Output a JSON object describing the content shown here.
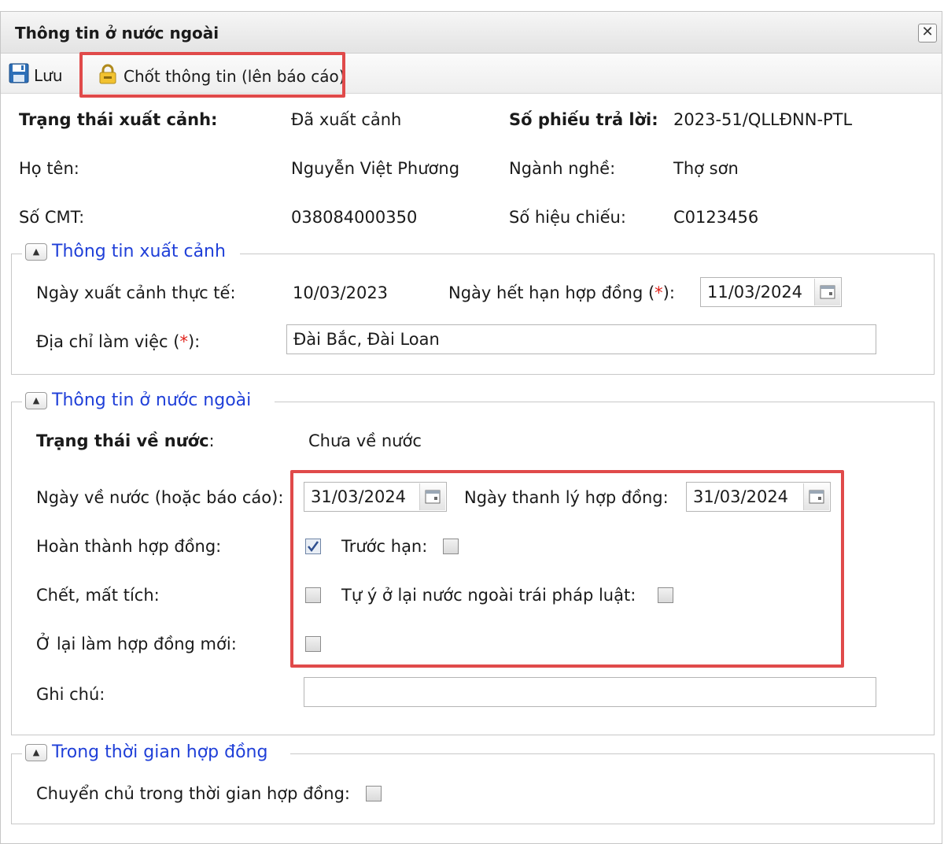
{
  "window": {
    "title": "Thông tin ở nước ngoài",
    "close_glyph": "✕"
  },
  "toolbar": {
    "save_label": "Lưu",
    "lock_label": "Chốt thông tin (lên báo cáo)"
  },
  "summary": {
    "exit_status_label": "Trạng thái xuất cảnh:",
    "exit_status_value": "Đã xuất cảnh",
    "reply_no_label": "Số phiếu trả lời:",
    "reply_no_value": "2023-51/QLLĐNN-PTL",
    "name_label": "Họ tên:",
    "name_value": "Nguyễn Việt Phương",
    "occupation_label": "Ngành nghề:",
    "occupation_value": "Thợ sơn",
    "id_label": "Số CMT:",
    "id_value": "038084000350",
    "passport_label": "Số hiệu chiếu:",
    "passport_value": "C0123456"
  },
  "exit_section": {
    "legend": "Thông tin xuất cảnh",
    "actual_exit_label": "Ngày xuất cảnh thực tế:",
    "actual_exit_value": "10/03/2023",
    "contract_end_label": "Ngày hết hạn hợp đồng (",
    "contract_end_value": "11/03/2024",
    "work_address_label": "Địa chỉ làm việc (",
    "work_address_value": "Đài Bắc, Đài Loan",
    "required_mark": "*",
    "label_close": "):"
  },
  "abroad_section": {
    "legend": "Thông tin ở nước ngoài",
    "return_status_label": "Trạng thái về nước",
    "return_status_colon": ":",
    "return_status_value": "Chưa về nước",
    "return_date_label": "Ngày về nước (hoặc báo cáo):",
    "return_date_value": "31/03/2024",
    "liquidation_label": "Ngày thanh lý hợp đồng:",
    "liquidation_value": "31/03/2024",
    "completed_label": "Hoàn thành hợp đồng:",
    "completed_checked": true,
    "early_label": "Trước hạn:",
    "early_checked": false,
    "dead_missing_label": "Chết, mất tích:",
    "dead_missing_checked": false,
    "illegal_stay_label": "Tự ý ở lại nước ngoài trái pháp luật:",
    "illegal_stay_checked": false,
    "new_contract_label": "Ở lại làm hợp đồng mới:",
    "new_contract_checked": false,
    "note_label": "Ghi chú:",
    "note_value": ""
  },
  "contract_section": {
    "legend": "Trong thời gian hợp đồng",
    "employer_change_label": "Chuyển chủ trong thời gian hợp đồng:",
    "employer_change_checked": false
  },
  "colors": {
    "highlight": "#e04a4a",
    "legend_text": "#1f3fd8",
    "required": "#e0221b"
  }
}
